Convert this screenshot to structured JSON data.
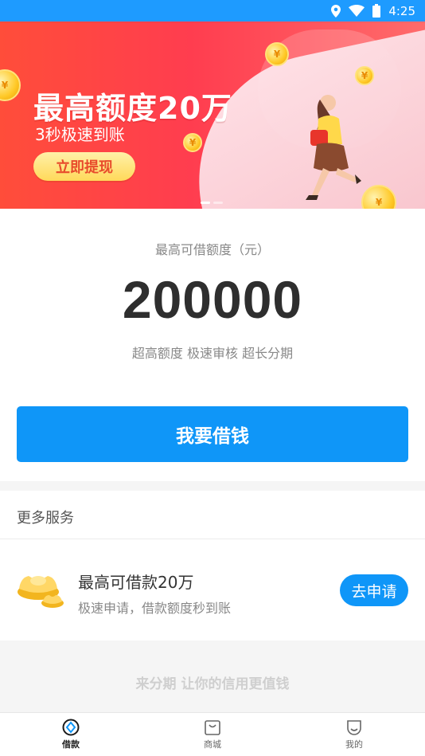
{
  "status_bar": {
    "time": "4:25",
    "icons": [
      "location-icon",
      "wifi-icon",
      "battery-icon"
    ]
  },
  "banner": {
    "title": "最高额度20万",
    "subtitle": "3秒极速到账",
    "button_label": "立即提现",
    "coin_symbol": "¥",
    "slides": 2,
    "active_slide": 0
  },
  "limit": {
    "label": "最高可借额度（元）",
    "amount": "200000",
    "tags": "超高额度 极速审核 超长分期"
  },
  "borrow_button": {
    "label": "我要借钱"
  },
  "services": {
    "title": "更多服务",
    "items": [
      {
        "icon": "gold-ingot-icon",
        "name": "最高可借款20万",
        "desc": "极速申请，借款额度秒到账",
        "button_label": "去申请"
      }
    ]
  },
  "slogan": {
    "text": "来分期 让你的信用更值钱"
  },
  "tabbar": {
    "tabs": [
      {
        "label": "借款",
        "icon": "loan-icon",
        "active": true
      },
      {
        "label": "商城",
        "icon": "shop-icon",
        "active": false
      },
      {
        "label": "我的",
        "icon": "profile-icon",
        "active": false
      }
    ]
  },
  "colors": {
    "primary": "#0f96f8",
    "status_bar": "#1e9bff",
    "banner_red": "#ff4d3a",
    "gold": "#ffc928"
  }
}
